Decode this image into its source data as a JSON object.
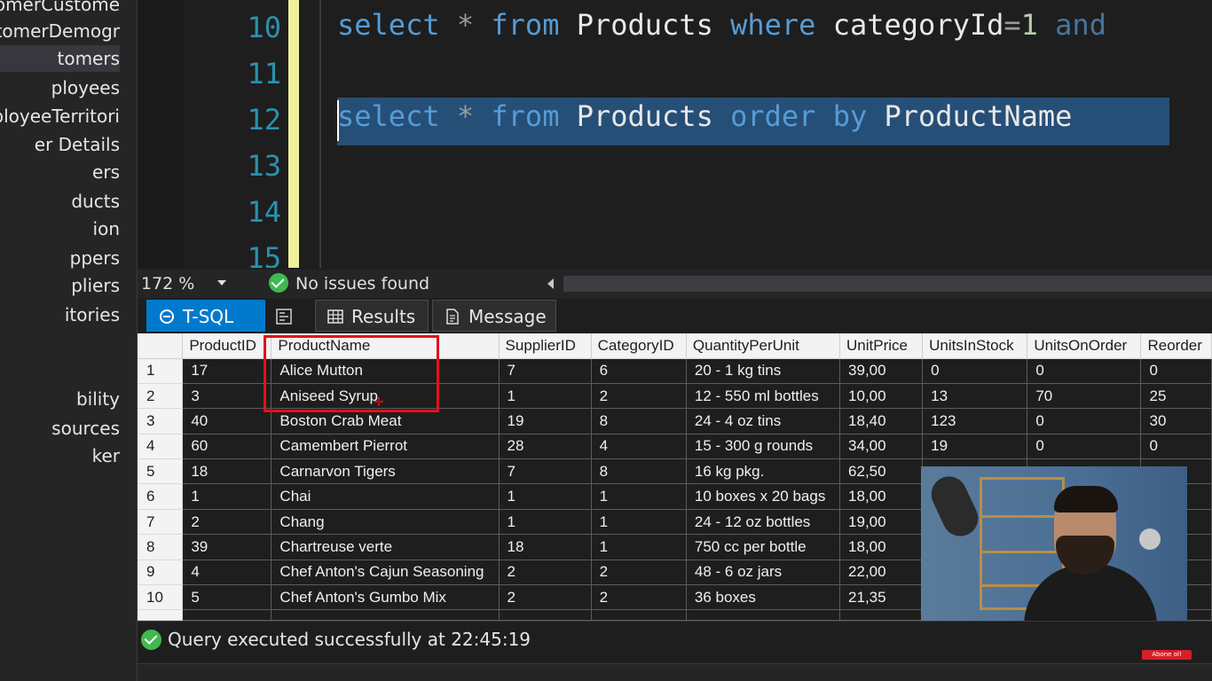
{
  "explorer": {
    "items": [
      {
        "label": "tomerCustome",
        "selected": false
      },
      {
        "label": "tomerDemogr",
        "selected": false
      },
      {
        "label": "tomers",
        "selected": true
      },
      {
        "label": "ployees",
        "selected": false
      },
      {
        "label": "ployeeTerritori",
        "selected": false
      },
      {
        "label": "er Details",
        "selected": false
      },
      {
        "label": "ers",
        "selected": false
      },
      {
        "label": "ducts",
        "selected": false
      },
      {
        "label": "ion",
        "selected": false
      },
      {
        "label": "ppers",
        "selected": false
      },
      {
        "label": "pliers",
        "selected": false
      },
      {
        "label": "itories",
        "selected": false
      },
      {
        "label": "bility",
        "selected": false
      },
      {
        "label": "sources",
        "selected": false
      },
      {
        "label": "ker",
        "selected": false
      }
    ]
  },
  "editor": {
    "line_numbers": [
      "10",
      "11",
      "12",
      "13",
      "14",
      "15"
    ],
    "line10": {
      "select": "select",
      "star": "*",
      "from": "from",
      "table": "Products",
      "where": "where",
      "column": "categoryId",
      "eq": "=",
      "value": "1",
      "and": "and"
    },
    "line12": {
      "select": "select",
      "star": "*",
      "from": "from",
      "table": "Products",
      "order": "order",
      "by": "by",
      "column": "ProductName"
    }
  },
  "status_row": {
    "zoom": "172 %",
    "issues": "No issues found"
  },
  "tabs": {
    "tsql": "T-SQL",
    "results": "Results",
    "message": "Message"
  },
  "grid": {
    "columns": [
      "ProductID",
      "ProductName",
      "SupplierID",
      "CategoryID",
      "QuantityPerUnit",
      "UnitPrice",
      "UnitsInStock",
      "UnitsOnOrder",
      "Reorder"
    ],
    "rows": [
      {
        "n": "1",
        "cells": [
          "17",
          "Alice Mutton",
          "7",
          "6",
          "20 - 1 kg tins",
          "39,00",
          "0",
          "0",
          "0"
        ]
      },
      {
        "n": "2",
        "cells": [
          "3",
          "Aniseed Syrup",
          "1",
          "2",
          "12 - 550 ml bottles",
          "10,00",
          "13",
          "70",
          "25"
        ]
      },
      {
        "n": "3",
        "cells": [
          "40",
          "Boston Crab Meat",
          "19",
          "8",
          "24 - 4 oz tins",
          "18,40",
          "123",
          "0",
          "30"
        ]
      },
      {
        "n": "4",
        "cells": [
          "60",
          "Camembert Pierrot",
          "28",
          "4",
          "15 - 300 g rounds",
          "34,00",
          "19",
          "0",
          "0"
        ]
      },
      {
        "n": "5",
        "cells": [
          "18",
          "Carnarvon Tigers",
          "7",
          "8",
          "16 kg pkg.",
          "62,50",
          "",
          "",
          ""
        ]
      },
      {
        "n": "6",
        "cells": [
          "1",
          "Chai",
          "1",
          "1",
          "10 boxes x 20 bags",
          "18,00",
          "",
          "",
          ""
        ]
      },
      {
        "n": "7",
        "cells": [
          "2",
          "Chang",
          "1",
          "1",
          "24 - 12 oz bottles",
          "19,00",
          "",
          "",
          ""
        ]
      },
      {
        "n": "8",
        "cells": [
          "39",
          "Chartreuse verte",
          "18",
          "1",
          "750 cc per bottle",
          "18,00",
          "",
          "",
          ""
        ]
      },
      {
        "n": "9",
        "cells": [
          "4",
          "Chef Anton's Cajun Seasoning",
          "2",
          "2",
          "48 - 6 oz jars",
          "22,00",
          "",
          "",
          ""
        ]
      },
      {
        "n": "10",
        "cells": [
          "5",
          "Chef Anton's Gumbo Mix",
          "2",
          "2",
          "36 boxes",
          "21,35",
          "",
          "",
          ""
        ]
      }
    ]
  },
  "status_bar": {
    "message": "Query executed successfully at 22:45:19"
  },
  "overlay": {
    "subscribe": "Abone ol!"
  },
  "colors": {
    "keyword": "#569cd6",
    "line_number": "#2b91af",
    "selection": "#264f78",
    "tab_active": "#007acc",
    "highlight_box": "#e3101c",
    "success": "#3fb950"
  }
}
